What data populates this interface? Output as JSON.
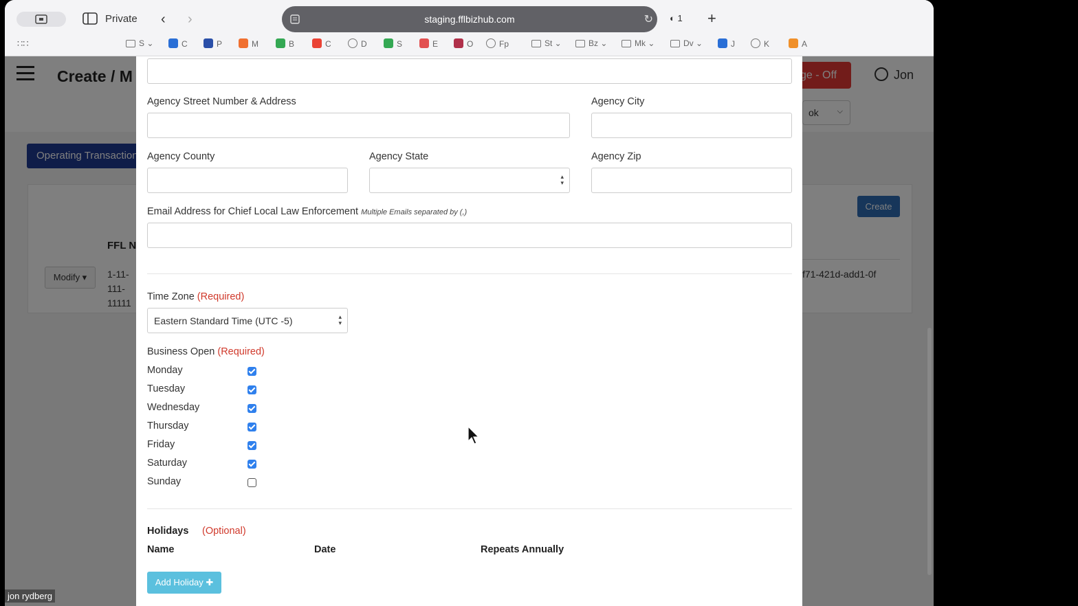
{
  "browser": {
    "private_label": "Private",
    "url": "staging.fflbizhub.com",
    "shield_count": "1",
    "bookmarks": [
      {
        "label": "S",
        "icon": "folder-icon",
        "color": "#777"
      },
      {
        "label": "C",
        "icon": "site-icon",
        "color": "#2a6fd6"
      },
      {
        "label": "P",
        "icon": "site-icon",
        "color": "#2a4fa8"
      },
      {
        "label": "M",
        "icon": "site-icon",
        "color": "#f07030"
      },
      {
        "label": "B",
        "icon": "site-icon",
        "color": "#34a853"
      },
      {
        "label": "C",
        "icon": "site-icon",
        "color": "#ea4335"
      },
      {
        "label": "D",
        "icon": "globe-icon",
        "color": "#777"
      },
      {
        "label": "S",
        "icon": "site-icon",
        "color": "#34a853"
      },
      {
        "label": "E",
        "icon": "site-icon",
        "color": "#e25050"
      },
      {
        "label": "O",
        "icon": "site-icon",
        "color": "#b0304a"
      },
      {
        "label": "Fp",
        "icon": "globe-icon",
        "color": "#777"
      },
      {
        "label": "St",
        "icon": "folder-icon",
        "color": "#777"
      },
      {
        "label": "Bz",
        "icon": "folder-icon",
        "color": "#777"
      },
      {
        "label": "Mk",
        "icon": "folder-icon",
        "color": "#777"
      },
      {
        "label": "Dv",
        "icon": "folder-icon",
        "color": "#777"
      },
      {
        "label": "J",
        "icon": "site-icon",
        "color": "#2a6fd6"
      },
      {
        "label": "K",
        "icon": "globe-icon",
        "color": "#777"
      },
      {
        "label": "A",
        "icon": "site-icon",
        "color": "#f0902a"
      }
    ]
  },
  "app": {
    "title": "Create / M",
    "mode_badge": "ge - Off",
    "user_name": "Jon",
    "select_value": "ok",
    "ops_tab": "Operating Transaction",
    "create_button": "Create",
    "ffl_header": "FFL N",
    "modify_button": "Modify ▾",
    "ffl_number": "1-11-111-11111",
    "uuid_fragment": "f71-421d-add1-0f"
  },
  "form": {
    "address_label": "Agency Street Number & Address",
    "city_label": "Agency City",
    "county_label": "Agency County",
    "state_label": "Agency State",
    "zip_label": "Agency Zip",
    "email_label": "Email Address for Chief Local Law Enforcement",
    "email_hint": "Multiple Emails separated by (,)",
    "timezone_label": "Time Zone",
    "required_tag": "(Required)",
    "timezone_value": "Eastern Standard Time (UTC -5)",
    "business_open_label": "Business Open",
    "days": [
      {
        "name": "Monday",
        "checked": true
      },
      {
        "name": "Tuesday",
        "checked": true
      },
      {
        "name": "Wednesday",
        "checked": true
      },
      {
        "name": "Thursday",
        "checked": true
      },
      {
        "name": "Friday",
        "checked": true
      },
      {
        "name": "Saturday",
        "checked": true
      },
      {
        "name": "Sunday",
        "checked": false
      }
    ],
    "holidays_label": "Holidays",
    "optional_tag": "(Optional)",
    "col_name": "Name",
    "col_date": "Date",
    "col_repeats": "Repeats Annually",
    "add_holiday_button": "Add Holiday ✚"
  },
  "overlay_tag": "jon rydberg"
}
